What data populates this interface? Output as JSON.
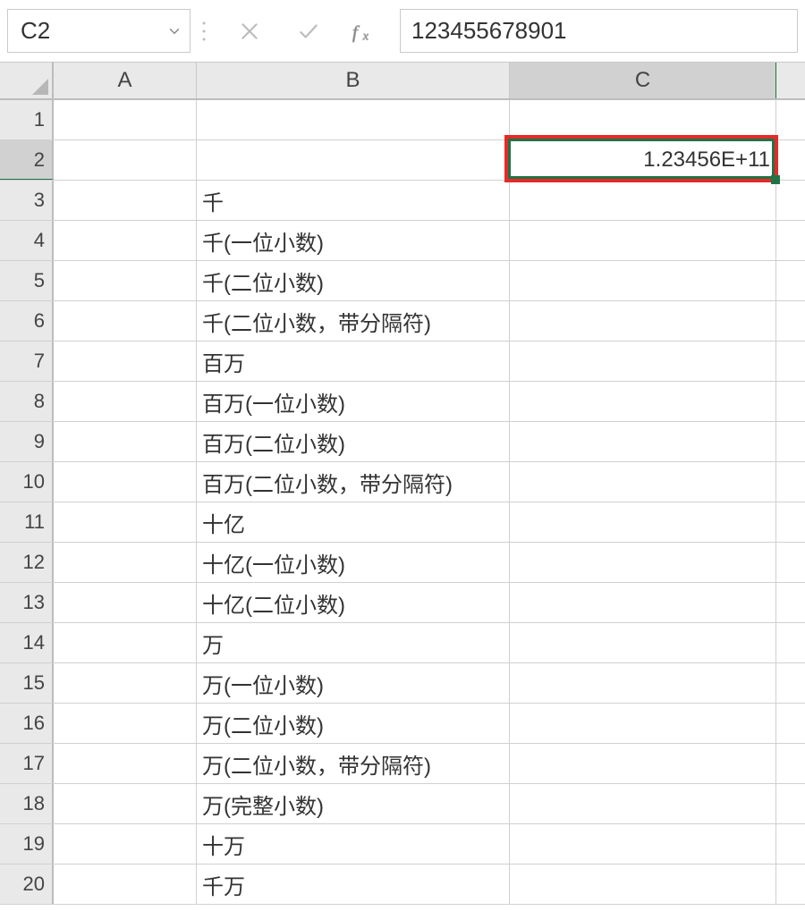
{
  "formula_bar": {
    "name_box": "C2",
    "formula_value": "123455678901"
  },
  "columns": [
    "A",
    "B",
    "C"
  ],
  "selection": {
    "cell_ref": "C2",
    "row": 2,
    "col": "C"
  },
  "rows": [
    {
      "num": "1",
      "A": "",
      "B": "",
      "C": ""
    },
    {
      "num": "2",
      "A": "",
      "B": "",
      "C": "1.23456E+11"
    },
    {
      "num": "3",
      "A": "",
      "B": "千",
      "C": ""
    },
    {
      "num": "4",
      "A": "",
      "B": "千(一位小数)",
      "C": ""
    },
    {
      "num": "5",
      "A": "",
      "B": "千(二位小数)",
      "C": ""
    },
    {
      "num": "6",
      "A": "",
      "B": "千(二位小数，带分隔符)",
      "C": ""
    },
    {
      "num": "7",
      "A": "",
      "B": "百万",
      "C": ""
    },
    {
      "num": "8",
      "A": "",
      "B": "百万(一位小数)",
      "C": ""
    },
    {
      "num": "9",
      "A": "",
      "B": "百万(二位小数)",
      "C": ""
    },
    {
      "num": "10",
      "A": "",
      "B": "百万(二位小数，带分隔符)",
      "C": ""
    },
    {
      "num": "11",
      "A": "",
      "B": "十亿",
      "C": ""
    },
    {
      "num": "12",
      "A": "",
      "B": "十亿(一位小数)",
      "C": ""
    },
    {
      "num": "13",
      "A": "",
      "B": "十亿(二位小数)",
      "C": ""
    },
    {
      "num": "14",
      "A": "",
      "B": "万",
      "C": ""
    },
    {
      "num": "15",
      "A": "",
      "B": "万(一位小数)",
      "C": ""
    },
    {
      "num": "16",
      "A": "",
      "B": "万(二位小数)",
      "C": ""
    },
    {
      "num": "17",
      "A": "",
      "B": "万(二位小数，带分隔符)",
      "C": ""
    },
    {
      "num": "18",
      "A": "",
      "B": "万(完整小数)",
      "C": ""
    },
    {
      "num": "19",
      "A": "",
      "B": "十万",
      "C": ""
    },
    {
      "num": "20",
      "A": "",
      "B": "千万",
      "C": ""
    }
  ]
}
